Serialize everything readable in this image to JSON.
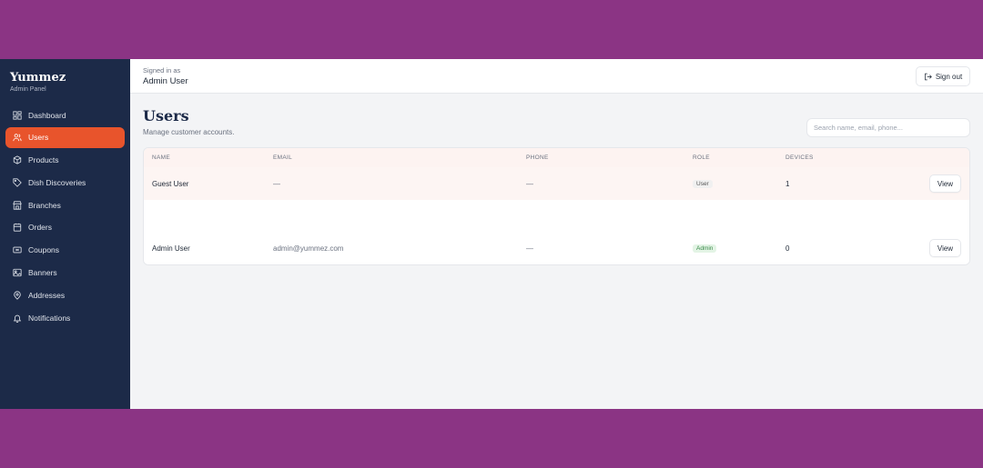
{
  "brand": {
    "title": "Yummez",
    "subtitle": "Admin Panel"
  },
  "sidebar": {
    "items": [
      {
        "label": "Dashboard",
        "icon": "dashboard-icon",
        "active": false
      },
      {
        "label": "Users",
        "icon": "users-icon",
        "active": true
      },
      {
        "label": "Products",
        "icon": "box-icon",
        "active": false
      },
      {
        "label": "Dish Discoveries",
        "icon": "tag-icon",
        "active": false
      },
      {
        "label": "Branches",
        "icon": "store-icon",
        "active": false
      },
      {
        "label": "Orders",
        "icon": "orders-icon",
        "active": false
      },
      {
        "label": "Coupons",
        "icon": "ticket-icon",
        "active": false
      },
      {
        "label": "Banners",
        "icon": "image-icon",
        "active": false
      },
      {
        "label": "Addresses",
        "icon": "map-pin-icon",
        "active": false
      },
      {
        "label": "Notifications",
        "icon": "bell-icon",
        "active": false
      }
    ]
  },
  "header": {
    "signed_in_label": "Signed in as",
    "user_name": "Admin User",
    "sign_out_label": "Sign out"
  },
  "page": {
    "title": "Users",
    "subtitle": "Manage customer accounts.",
    "search_placeholder": "Search name, email, phone..."
  },
  "table": {
    "columns": [
      "NAME",
      "EMAIL",
      "PHONE",
      "ROLE",
      "DEVICES"
    ],
    "rows": [
      {
        "name": "Guest User",
        "email": "—",
        "phone": "—",
        "role": "User",
        "devices": "1",
        "action": "View"
      },
      {
        "name": "Admin User",
        "email": "admin@yummez.com",
        "phone": "—",
        "role": "Admin",
        "devices": "0",
        "action": "View"
      }
    ]
  },
  "colors": {
    "sidebar_bg": "#1c2a48",
    "accent": "#e8542c",
    "outer_bg": "#8b3484"
  }
}
